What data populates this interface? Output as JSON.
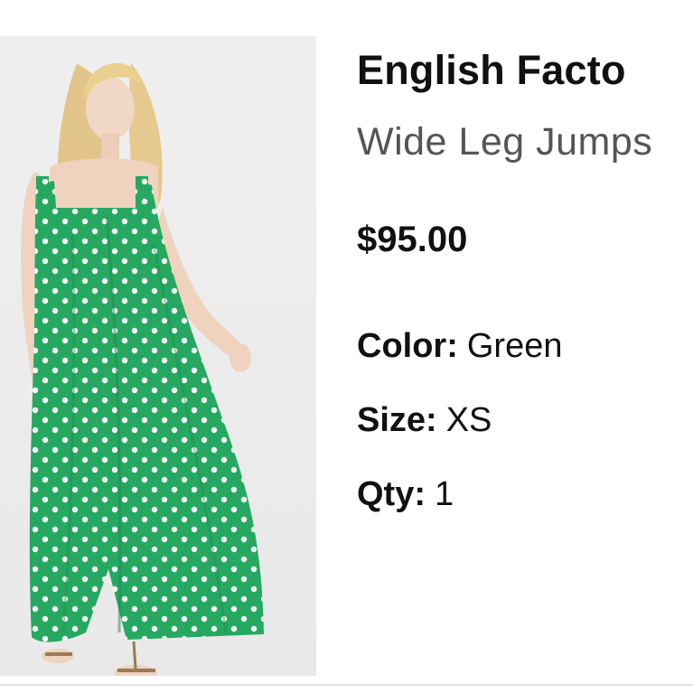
{
  "product": {
    "brand": "English Facto",
    "name": "Wide Leg Jumps",
    "price": "$95.00",
    "image_alt": "product-photo-green-polka-dot-jumpsuit"
  },
  "attributes": {
    "color_label": "Color:",
    "color_value": "Green",
    "size_label": "Size:",
    "size_value": "XS",
    "qty_label": "Qty:",
    "qty_value": "1"
  },
  "colors": {
    "jumpsuit_green": "#26a860",
    "dots": "#f5fff8",
    "hair": "#e6c98f",
    "skin": "#f1d8c6",
    "background": "#ededed"
  }
}
